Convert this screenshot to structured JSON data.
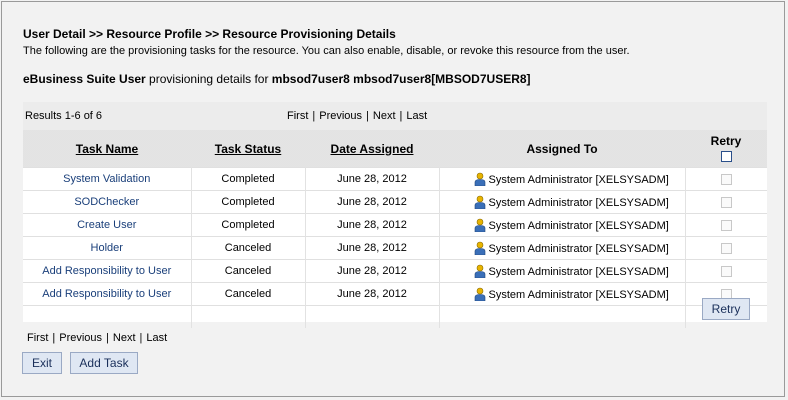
{
  "breadcrumb": "User Detail >> Resource Profile >> Resource Provisioning Details",
  "instructions": "The following are the provisioning tasks for the resource. You can also enable, disable, or revoke this resource from the user.",
  "subtitle": {
    "resource": "eBusiness Suite User",
    "middle": " provisioning details for ",
    "user": "mbsod7user8 mbsod7user8[MBSOD7USER8]"
  },
  "results": {
    "count_text": "Results 1-6 of 6"
  },
  "pager": {
    "first": "First",
    "previous": "Previous",
    "next": "Next",
    "last": "Last",
    "sep": "|"
  },
  "table": {
    "headers": {
      "task_name": "Task Name",
      "task_status": "Task Status",
      "date_assigned": "Date Assigned",
      "assigned_to": "Assigned To",
      "retry": "Retry"
    },
    "rows": [
      {
        "task": "System Validation",
        "status": "Completed",
        "date": "June 28, 2012",
        "assigned": "System Administrator [XELSYSADM]"
      },
      {
        "task": "SODChecker",
        "status": "Completed",
        "date": "June 28, 2012",
        "assigned": "System Administrator [XELSYSADM]"
      },
      {
        "task": "Create User",
        "status": "Completed",
        "date": "June 28, 2012",
        "assigned": "System Administrator [XELSYSADM]"
      },
      {
        "task": "Holder",
        "status": "Canceled",
        "date": "June 28, 2012",
        "assigned": "System Administrator [XELSYSADM]"
      },
      {
        "task": "Add Responsibility to User",
        "status": "Canceled",
        "date": "June 28, 2012",
        "assigned": "System Administrator [XELSYSADM]"
      },
      {
        "task": "Add Responsibility to User",
        "status": "Canceled",
        "date": "June 28, 2012",
        "assigned": "System Administrator [XELSYSADM]"
      }
    ]
  },
  "buttons": {
    "retry": "Retry",
    "exit": "Exit",
    "add_task": "Add Task"
  },
  "icons": {
    "assigned_user": "person-icon"
  },
  "colors": {
    "link": "#1a3f7a",
    "button_bg": "#dfe7f3",
    "button_border": "#9aa9c4"
  }
}
